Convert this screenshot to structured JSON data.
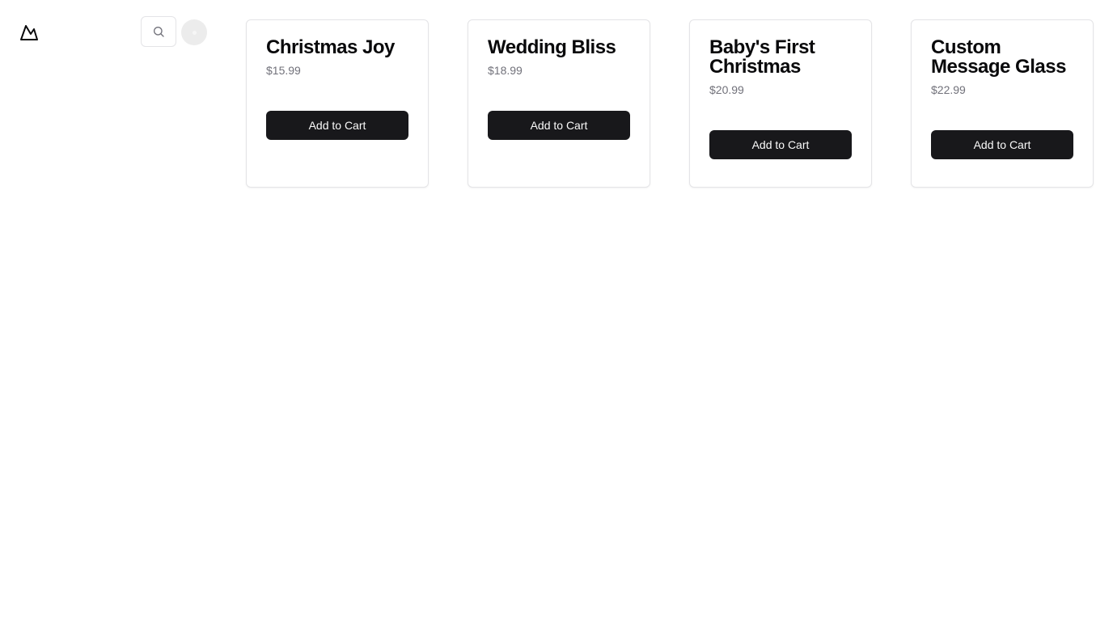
{
  "header": {
    "logo_icon": "mountain-icon",
    "search_icon": "search-icon"
  },
  "products": [
    {
      "name": "Christmas Joy",
      "price": "$15.99",
      "button_label": "Add to Cart"
    },
    {
      "name": "Wedding Bliss",
      "price": "$18.99",
      "button_label": "Add to Cart"
    },
    {
      "name": "Baby's First Christmas",
      "price": "$20.99",
      "button_label": "Add to Cart"
    },
    {
      "name": "Custom Message Glass",
      "price": "$22.99",
      "button_label": "Add to Cart"
    }
  ],
  "colors": {
    "button_bg": "#18181b",
    "button_text": "#fafafa",
    "price_text": "#71717a",
    "card_border": "#e4e4e7"
  }
}
